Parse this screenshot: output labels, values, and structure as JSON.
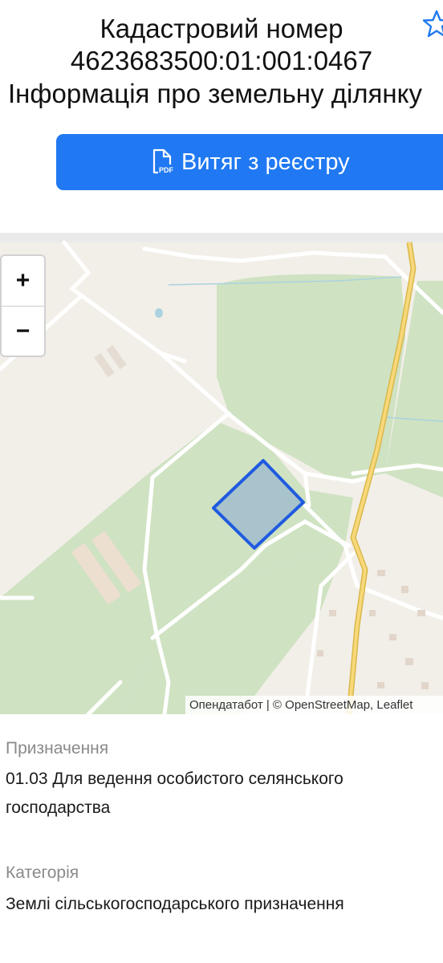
{
  "header": {
    "title": "Кадастровий номер",
    "cadastral_number": "4623683500:01:001:0467",
    "subtitle": "Інформація про земельну ділянку",
    "favorite_icon": "star-outline-icon"
  },
  "actions": {
    "extract_button": "Витяг з реєстру",
    "extract_icon": "pdf-file-icon",
    "accent_color": "#2079f2"
  },
  "map": {
    "zoom_in": "+",
    "zoom_out": "−",
    "attribution": "Опендатабот | © OpenStreetMap, Leaflet",
    "parcel_color": "#1f5be0"
  },
  "details": {
    "purpose_label": "Призначення",
    "purpose_value_line1": "01.03 Для ведення особистого селянського",
    "purpose_value_line2": "господарства",
    "category_label": "Категорія",
    "category_value": "Землі сільськогосподарського призначення"
  }
}
